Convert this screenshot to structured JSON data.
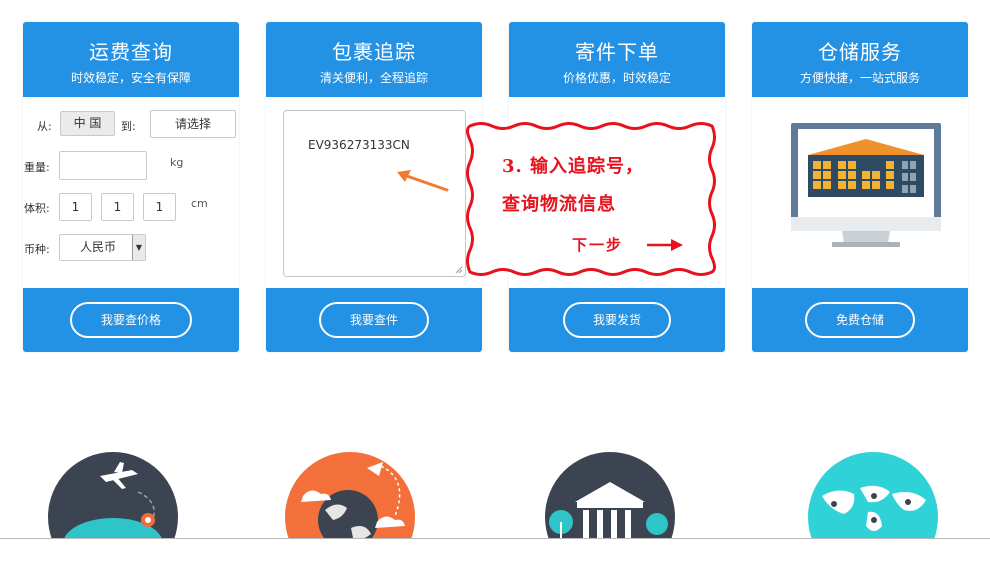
{
  "cards": [
    {
      "title": "运费查询",
      "subtitle": "时效稳定，安全有保障",
      "button": "我要查价格"
    },
    {
      "title": "包裹追踪",
      "subtitle": "清关便利，全程追踪",
      "button": "我要查件"
    },
    {
      "title": "寄件下单",
      "subtitle": "价格优惠，时效稳定",
      "button": "我要发货"
    },
    {
      "title": "仓储服务",
      "subtitle": "方便快捷，一站式服务",
      "button": "免费仓储"
    }
  ],
  "shipping_form": {
    "from_label": "从:",
    "from_value": "中 国",
    "to_label": "到:",
    "to_value": "请选择",
    "weight_label": "重量:",
    "weight_unit": "kg",
    "volume_label": "体积:",
    "volume_values": [
      "1",
      "1",
      "1"
    ],
    "volume_unit": "cm",
    "currency_label": "币种:",
    "currency_value": "人民币"
  },
  "tracking": {
    "number": "EV936273133CN"
  },
  "callout": {
    "line1": "3. 输入追踪号，",
    "line2": "查询物流信息",
    "next": "下一步"
  },
  "colors": {
    "primary": "#2391e4",
    "callout_red": "#e8121d",
    "arrow_orange": "#f07b2f"
  }
}
